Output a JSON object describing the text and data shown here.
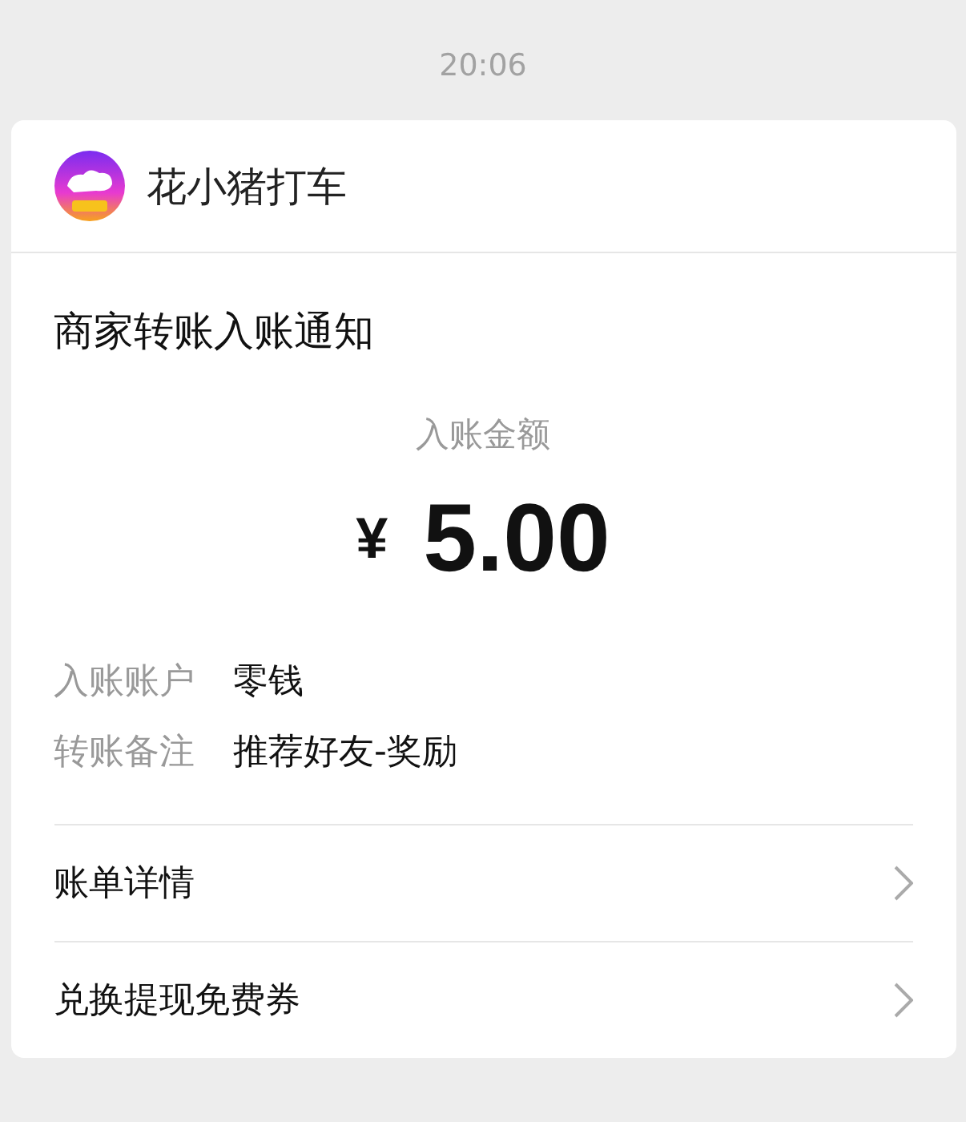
{
  "time": "20:06",
  "card": {
    "sender": "花小猪打车",
    "title": "商家转账入账通知",
    "amount_label": "入账金额",
    "currency": "¥",
    "amount": "5.00",
    "details": [
      {
        "label": "入账账户",
        "value": "零钱"
      },
      {
        "label": "转账备注",
        "value": "推荐好友-奖励"
      }
    ],
    "links": [
      {
        "label": "账单详情"
      },
      {
        "label": "兑换提现免费券"
      }
    ]
  }
}
